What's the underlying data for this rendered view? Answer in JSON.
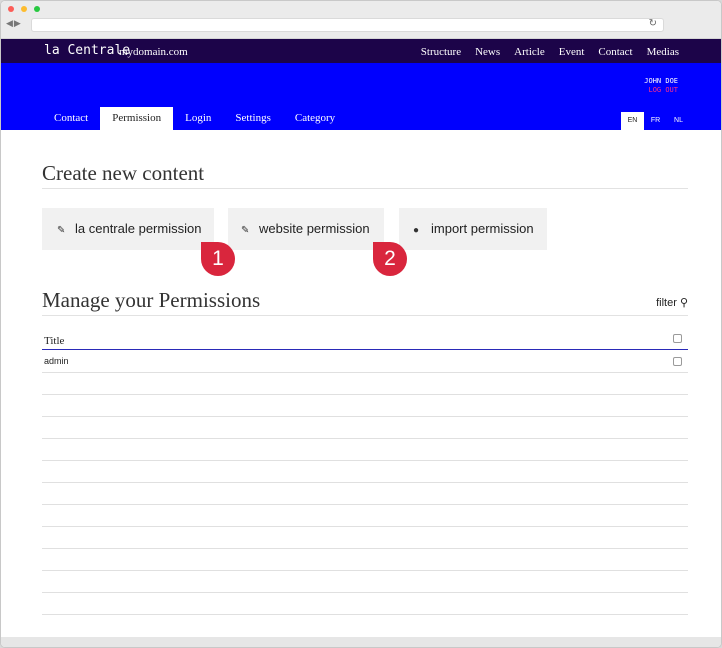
{
  "header": {
    "brand": "la Centrale",
    "domain": "mydomain.com",
    "nav": [
      "Structure",
      "News",
      "Article",
      "Event",
      "Contact",
      "Medias"
    ]
  },
  "user": {
    "name": "JOHN DOE",
    "logout": "LOG OUT"
  },
  "tabs": [
    "Contact",
    "Permission",
    "Login",
    "Settings",
    "Category"
  ],
  "active_tab": "Permission",
  "languages": [
    "EN",
    "FR",
    "NL"
  ],
  "active_language": "EN",
  "create": {
    "heading": "Create new content",
    "buttons": [
      {
        "label": "la centrale permission",
        "icon": "pencil-icon"
      },
      {
        "label": "website permission",
        "icon": "pencil-icon"
      },
      {
        "label": "import permission",
        "icon": "download-circle-icon"
      }
    ]
  },
  "annotations": [
    "1",
    "2"
  ],
  "manage": {
    "heading": "Manage your Permissions",
    "filter_label": "filter",
    "column_title": "Title",
    "rows": [
      "admin"
    ]
  },
  "colors": {
    "topbar": "#1c0449",
    "bluebar": "#0000fe",
    "logout": "#ff2d8a",
    "badge": "#d9263d"
  }
}
